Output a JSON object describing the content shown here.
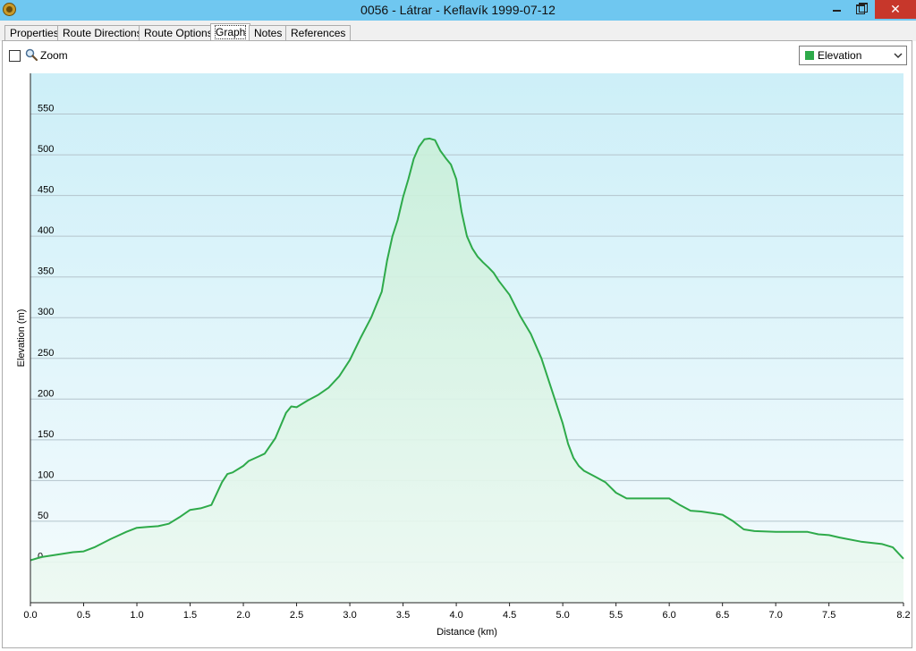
{
  "window": {
    "title": "0056 - Látrar - Keflavík 1999-07-12",
    "icon": "compass-app-icon",
    "close_glyph": "✕"
  },
  "tabs": [
    {
      "label": "Properties",
      "active": false
    },
    {
      "label": "Route Directions",
      "active": false
    },
    {
      "label": "Route Options",
      "active": false
    },
    {
      "label": "Graph",
      "active": true
    },
    {
      "label": "Notes",
      "active": false
    },
    {
      "label": "References",
      "active": false
    }
  ],
  "toolbar": {
    "zoom_label": "Zoom",
    "zoom_checked": false,
    "series_select_value": "Elevation",
    "series_color": "#2eaa4a"
  },
  "chart_data": {
    "type": "area",
    "xlabel": "Distance  (km)",
    "ylabel": "Elevation (m)",
    "xlim": [
      0,
      8.2
    ],
    "ylim": [
      -50,
      600
    ],
    "x_ticks": [
      "0.0",
      "0.5",
      "1.0",
      "1.5",
      "2.0",
      "2.5",
      "3.0",
      "3.5",
      "4.0",
      "4.5",
      "5.0",
      "5.5",
      "6.0",
      "6.5",
      "7.0",
      "7.5",
      "8.2"
    ],
    "y_ticks": [
      "0",
      "50",
      "100",
      "150",
      "200",
      "250",
      "300",
      "350",
      "400",
      "450",
      "500",
      "550"
    ],
    "grid": true,
    "line_color": "#2eaa4a",
    "series": [
      {
        "x": [
          0.0,
          0.1,
          0.25,
          0.4,
          0.5,
          0.6,
          0.75,
          0.9,
          1.0,
          1.1,
          1.2,
          1.3,
          1.4,
          1.5,
          1.6,
          1.7,
          1.8,
          1.85,
          1.9,
          2.0,
          2.05,
          2.15,
          2.2,
          2.3,
          2.4,
          2.45,
          2.5,
          2.6,
          2.7,
          2.8,
          2.9,
          3.0,
          3.1,
          3.2,
          3.3,
          3.35,
          3.4,
          3.45,
          3.5,
          3.55,
          3.6,
          3.65,
          3.7,
          3.75,
          3.8,
          3.85,
          3.9,
          3.95,
          4.0,
          4.05,
          4.1,
          4.15,
          4.2,
          4.25,
          4.3,
          4.35,
          4.4,
          4.5,
          4.6,
          4.7,
          4.8,
          4.9,
          5.0,
          5.05,
          5.1,
          5.15,
          5.2,
          5.3,
          5.4,
          5.5,
          5.6,
          5.7,
          5.8,
          6.0,
          6.1,
          6.2,
          6.3,
          6.4,
          6.5,
          6.6,
          6.7,
          6.8,
          7.0,
          7.3,
          7.4,
          7.5,
          7.6,
          7.8,
          8.0,
          8.1,
          8.2
        ],
        "y": [
          2,
          6,
          9,
          12,
          13,
          18,
          28,
          37,
          42,
          43,
          44,
          47,
          55,
          64,
          66,
          70,
          98,
          108,
          110,
          118,
          124,
          130,
          133,
          152,
          183,
          191,
          190,
          198,
          205,
          214,
          228,
          248,
          275,
          300,
          332,
          370,
          400,
          420,
          448,
          470,
          495,
          510,
          519,
          520,
          518,
          505,
          496,
          488,
          470,
          430,
          400,
          385,
          375,
          368,
          362,
          355,
          345,
          328,
          302,
          280,
          250,
          210,
          170,
          145,
          128,
          118,
          112,
          105,
          98,
          85,
          78,
          78,
          78,
          78,
          70,
          63,
          62,
          60,
          58,
          50,
          40,
          38,
          37,
          37,
          34,
          33,
          30,
          25,
          22,
          18,
          4
        ]
      }
    ]
  }
}
